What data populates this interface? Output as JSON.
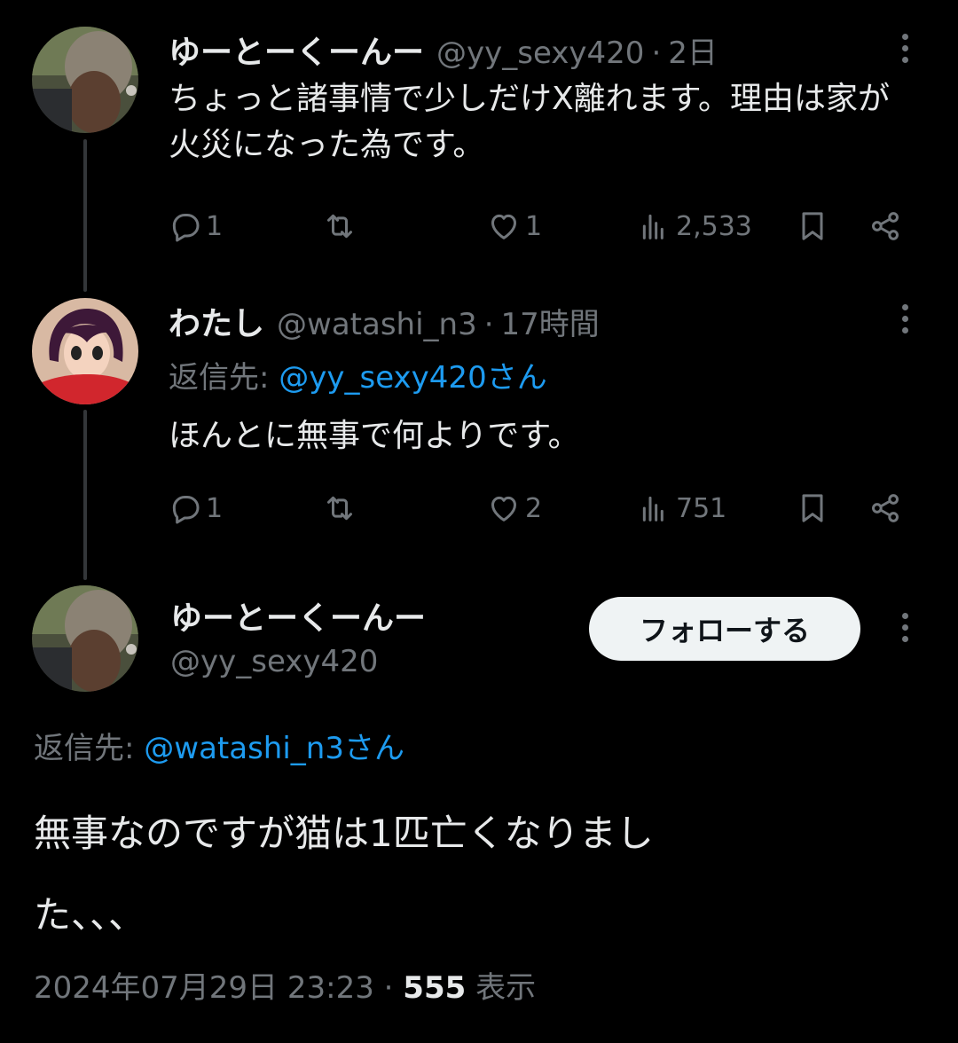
{
  "tweets": [
    {
      "display_name": "ゆーとーくーんー",
      "handle": "@yy_sexy420",
      "time": "2日",
      "text": "ちょっと諸事情で少しだけX離れます。理由は家が火災になった為です。",
      "replies": "1",
      "likes": "1",
      "views": "2,533"
    },
    {
      "display_name": "わたし",
      "handle": "@watashi_n3",
      "time": "17時間",
      "reply_prefix": "返信先:",
      "reply_to": "@yy_sexy420さん",
      "text": "ほんとに無事で何よりです。",
      "replies": "1",
      "likes": "2",
      "views": "751"
    }
  ],
  "main_tweet": {
    "display_name": "ゆーとーくーんー",
    "handle": "@yy_sexy420",
    "follow_label": "フォローする",
    "reply_prefix": "返信先:",
    "reply_to": "@watashi_n3さん",
    "text_line1": "無事なのですが猫は1匹亡くなりまし",
    "text_line2": "た、、、",
    "date": "2024年07月29日 23:23",
    "separator": "·",
    "view_count": "555",
    "view_label": "表示"
  },
  "colors": {
    "background": "#000000",
    "text": "#e7e9ea",
    "secondary": "#71767b",
    "link": "#1d9bf0",
    "follow_bg": "#eff3f4"
  },
  "icons": [
    "reply-icon",
    "retweet-icon",
    "like-icon",
    "views-icon",
    "bookmark-icon",
    "share-icon",
    "more-icon"
  ]
}
